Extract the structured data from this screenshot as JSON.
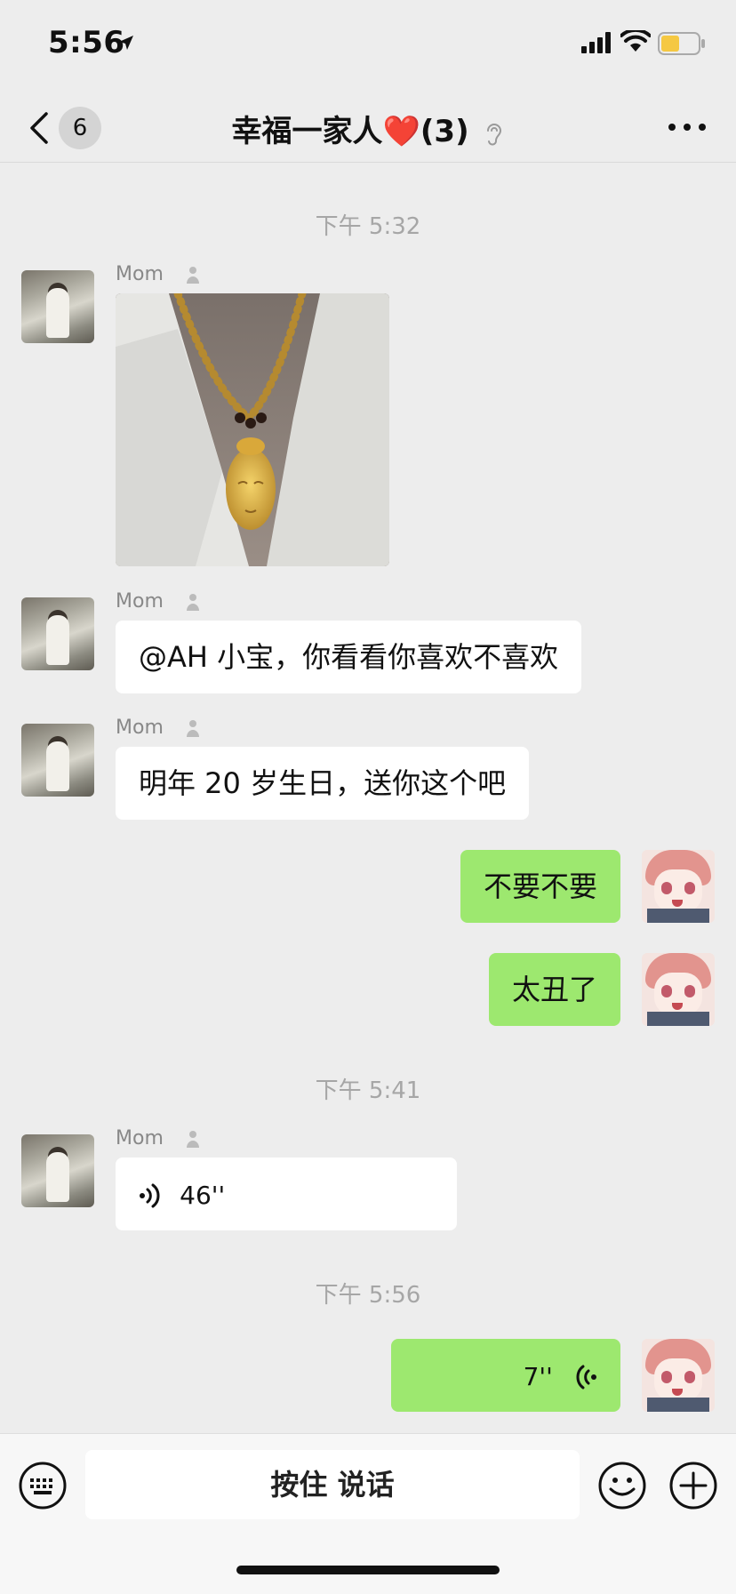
{
  "status_bar": {
    "time": "5:56",
    "battery_color": "#f5c842"
  },
  "nav": {
    "unread_count": "6",
    "title_text": "幸福一家人",
    "title_emoji": "❤️",
    "title_count": "(3)"
  },
  "messages": [
    {
      "type": "timestamp",
      "text": "下午 5:32"
    },
    {
      "type": "image",
      "sender": "Mom",
      "direction": "in"
    },
    {
      "type": "text",
      "sender": "Mom",
      "direction": "in",
      "text": "@AH 小宝，你看看你喜欢不喜欢"
    },
    {
      "type": "text",
      "sender": "Mom",
      "direction": "in",
      "text": "明年 20 岁生日，送你这个吧"
    },
    {
      "type": "text",
      "direction": "out",
      "text": "不要不要"
    },
    {
      "type": "text",
      "direction": "out",
      "text": "太丑了"
    },
    {
      "type": "timestamp",
      "text": "下午 5:41"
    },
    {
      "type": "voice",
      "sender": "Mom",
      "direction": "in",
      "duration": "46''"
    },
    {
      "type": "timestamp",
      "text": "下午 5:56"
    },
    {
      "type": "voice",
      "direction": "out",
      "duration": "7''"
    }
  ],
  "input_bar": {
    "hold_to_talk_label": "按住 说话"
  },
  "colors": {
    "outgoing_bubble": "#9de86f",
    "incoming_bubble": "#ffffff",
    "background": "#ededed"
  },
  "icons": [
    "location-arrow-icon",
    "cellular-signal-icon",
    "wifi-icon",
    "battery-icon",
    "back-chevron-icon",
    "mute-ear-icon",
    "more-dots-icon",
    "person-icon",
    "voice-wave-icon",
    "keyboard-icon",
    "emoji-icon",
    "plus-icon"
  ]
}
